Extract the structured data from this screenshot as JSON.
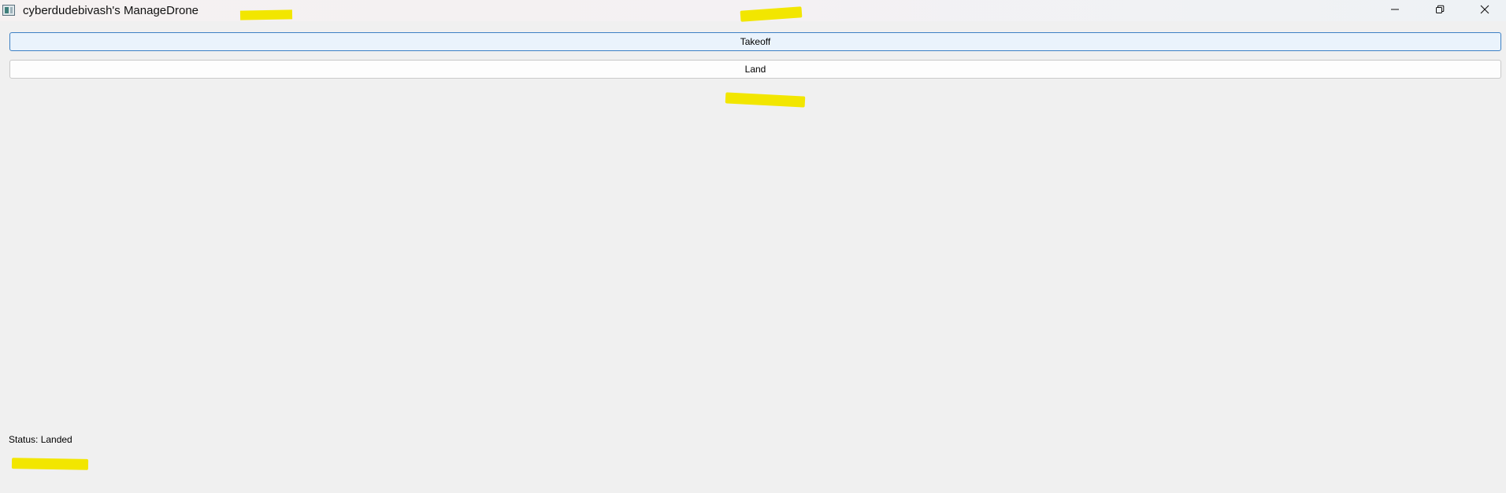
{
  "window": {
    "title": "cyberdudebivash's ManageDrone",
    "icon": "app-window-icon",
    "controls": [
      "minimize-icon",
      "restore-icon",
      "close-icon"
    ]
  },
  "buttons": {
    "takeoff_label": "Takeoff",
    "land_label": "Land"
  },
  "status": {
    "text": "Status: Landed"
  },
  "colors": {
    "background": "#f0f0f0",
    "focus_border": "#3d80c4",
    "focus_fill": "#eaf3fc",
    "highlight": "#f2e600"
  }
}
